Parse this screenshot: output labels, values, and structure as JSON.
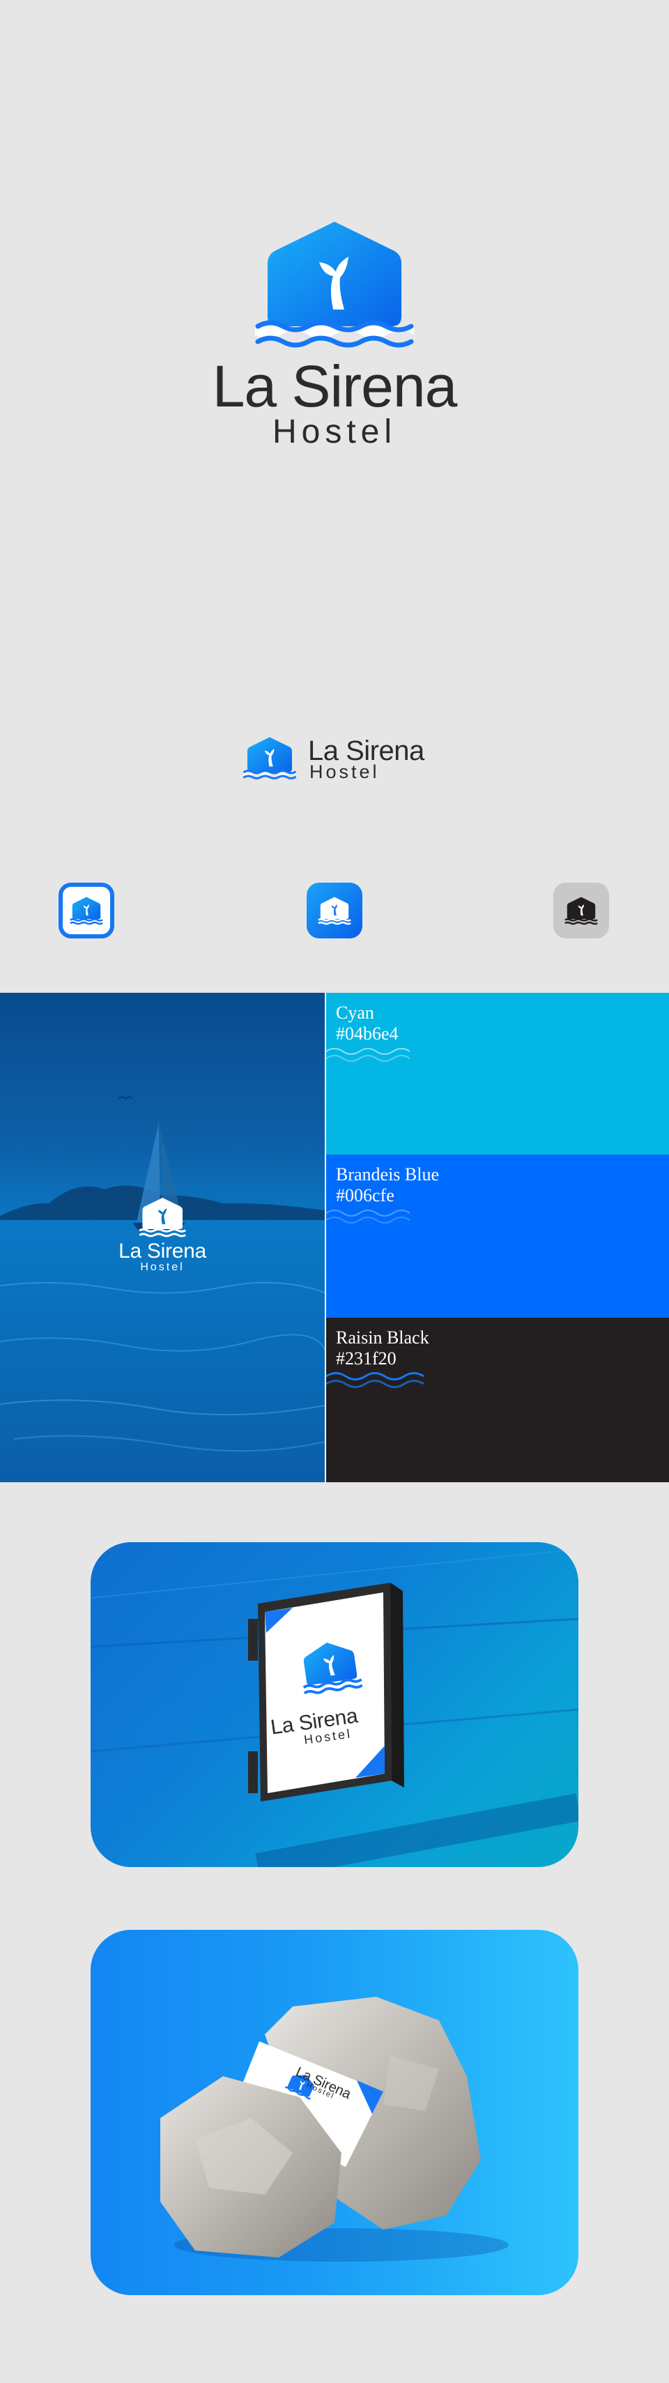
{
  "brand": {
    "name": "La Sirena",
    "tagline": "Hostel"
  },
  "icons": {
    "mark": "house-tail-waves-icon",
    "ocean": "ocean-photo",
    "sign": "storefront-sign",
    "stone": "business-card-on-stone"
  },
  "palette": [
    {
      "name": "Cyan",
      "hex": "#04b6e4"
    },
    {
      "name": "Brandeis Blue",
      "hex": "#006cfe"
    },
    {
      "name": "Raisin Black",
      "hex": "#231f20"
    }
  ],
  "colors": {
    "page_background": "#e6e6e7",
    "logo_gradient_start": "#1ab0f7",
    "logo_gradient_end": "#0a63ea",
    "wordmark": "#2b2b2b"
  }
}
